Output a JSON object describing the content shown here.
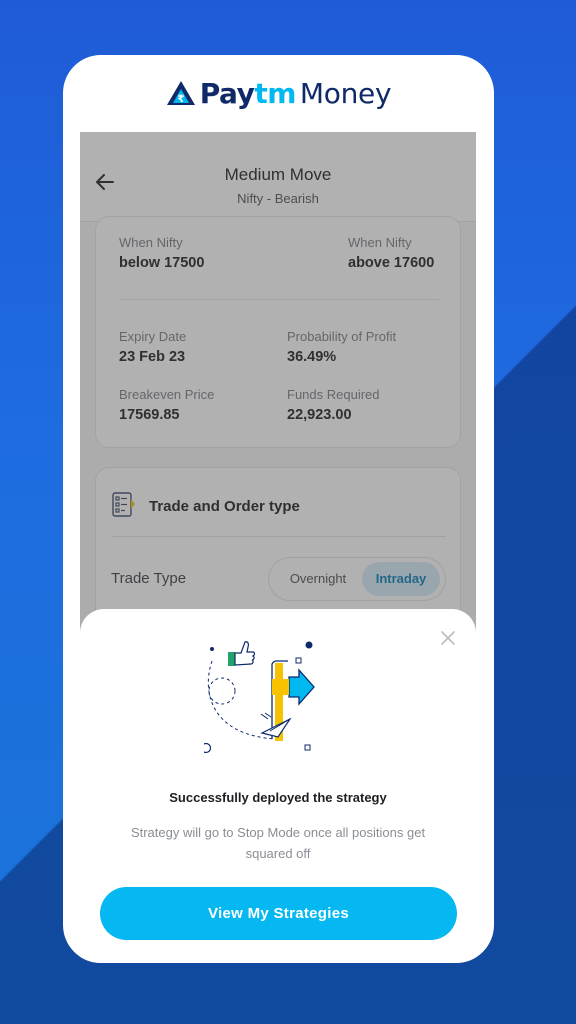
{
  "brand": {
    "part1": "Pay",
    "part2": "tm",
    "part3": "Money",
    "accent": "#00b9f1",
    "navy": "#102a68"
  },
  "header": {
    "title": "Medium Move",
    "subtitle": "Nifty - Bearish",
    "back_icon": "arrow-left-icon"
  },
  "range": {
    "left_label": "When Nifty",
    "left_value": "below 17500",
    "right_label": "When Nifty",
    "right_value": "above 17600"
  },
  "stats": [
    {
      "label": "Expiry Date",
      "value": "23 Feb 23"
    },
    {
      "label": "Probability of Profit",
      "value": "36.49%"
    },
    {
      "label": "Breakeven Price",
      "value": "17569.85"
    },
    {
      "label": "Funds Required",
      "value": "22,923.00"
    }
  ],
  "order_section": {
    "title": "Trade and Order type",
    "trade_type_label": "Trade Type",
    "options": [
      "Overnight",
      "Intraday"
    ],
    "selected": "Intraday"
  },
  "sheet": {
    "title": "Successfully deployed the strategy",
    "description": "Strategy will go to Stop Mode once all positions get squared off",
    "button": "View My Strategies",
    "close_icon": "close-icon",
    "button_color": "#05b8f2"
  }
}
